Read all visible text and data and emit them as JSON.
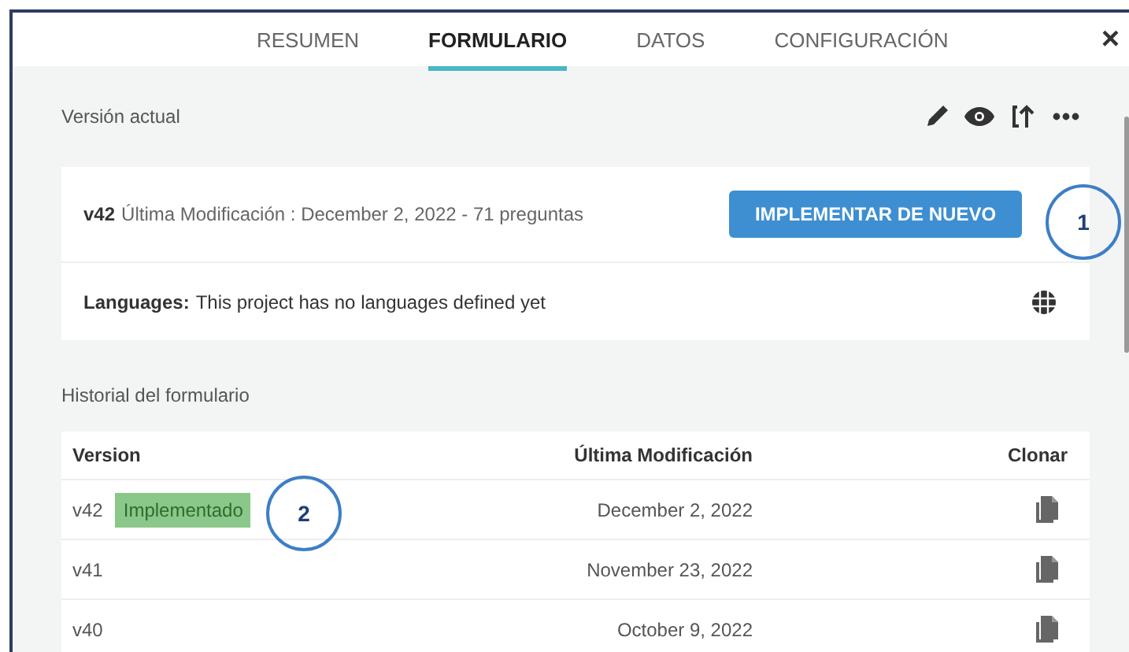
{
  "tabs": [
    {
      "label": "RESUMEN",
      "selected": false
    },
    {
      "label": "FORMULARIO",
      "selected": true
    },
    {
      "label": "DATOS",
      "selected": false
    },
    {
      "label": "CONFIGURACIÓN",
      "selected": false
    }
  ],
  "close": "×",
  "current_version": {
    "title": "Versión actual",
    "version": "v42",
    "details": "Última Modificación : December 2, 2022 - 71 preguntas",
    "button": "IMPLEMENTAR DE NUEVO",
    "languages_label": "Languages:",
    "languages_text": "This project has no languages defined yet"
  },
  "history": {
    "title": "Historial del formulario",
    "columns": [
      "Version",
      "Última Modificación",
      "Clonar"
    ],
    "rows": [
      {
        "version": "v42",
        "badge": "Implementado",
        "date": "December 2, 2022"
      },
      {
        "version": "v41",
        "date": "November 23, 2022"
      },
      {
        "version": "v40",
        "date": "October 9, 2022"
      }
    ]
  },
  "callouts": [
    {
      "label": "1"
    },
    {
      "label": "2"
    }
  ]
}
